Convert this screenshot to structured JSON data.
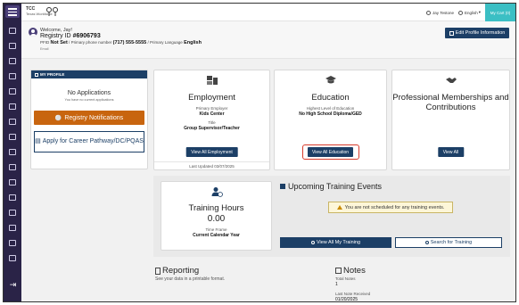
{
  "header": {
    "logo_line1": "TCC",
    "logo_line2": "Texas Workforce",
    "user_name": "Jay Testone",
    "language": "English",
    "cart_label": "My Cart (0)"
  },
  "welcome": {
    "greeting": "Welcome, Jay!",
    "registry_label": "Registry ID",
    "registry_id": "#6906793",
    "pfid_label": "PFID",
    "pfid_status": "Not Set",
    "phone_label": "Primary phone number",
    "phone": "(717) 555-5555",
    "language_label": "Primary Language",
    "language": "English",
    "email_label": "Email",
    "edit_button": "Edit Profile Information"
  },
  "profile": {
    "header": "MY PROFILE",
    "no_apps": "No Applications",
    "no_apps_sub": "You have no current applications",
    "reg_notifications": "Registry Notifications",
    "apply_career": "Apply for Career Pathway/DC/PQAS"
  },
  "employment": {
    "title": "Employment",
    "employer_label": "Primary Employer",
    "employer": "Kids Center",
    "title_label": "Title",
    "job_title": "Group Supervisor/Teacher",
    "button": "View All Employment",
    "last_updated": "Last Updated 03/07/2025"
  },
  "education": {
    "title": "Education",
    "level_label": "Highest Level of Education",
    "level": "No High School Diploma/GED",
    "button": "View All Education"
  },
  "professional": {
    "title": "Professional Memberships and Contributions",
    "button": "View All"
  },
  "training_hours": {
    "title": "Training Hours",
    "value": "0.00",
    "timeframe_label": "Time Frame",
    "timeframe": "Current Calendar Year"
  },
  "events": {
    "title": "Upcoming Training Events",
    "notice": "You are not scheduled for any training events.",
    "view_button": "View All My Training",
    "search_button": "Search for Training"
  },
  "reporting": {
    "title": "Reporting",
    "subtitle": "See your data in a printable format."
  },
  "notes": {
    "title": "Notes",
    "total_label": "Total Notes",
    "total": "1",
    "last_label": "Last Note Received",
    "last": "01/20/2025"
  },
  "colors": {
    "sidebar": "#2a2347",
    "navy": "#1c3f66",
    "orange": "#c8650f",
    "teal": "#3bbfc4",
    "highlight": "#d73b2c"
  }
}
